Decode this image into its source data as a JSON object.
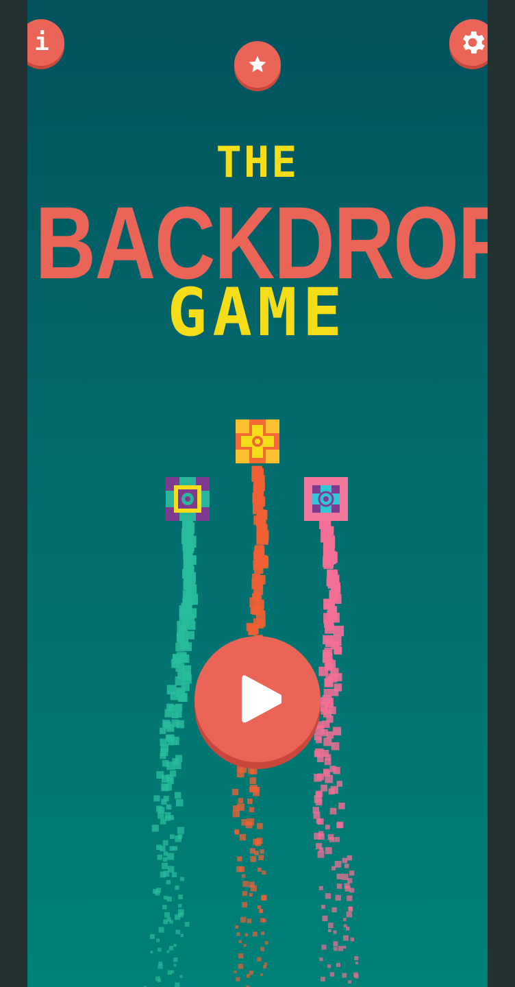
{
  "title": {
    "line1": "THE",
    "line2": "BACKDROP",
    "line3": "GAME"
  },
  "buttons": {
    "info": {
      "icon": "info-icon",
      "glyph": "i"
    },
    "achievements": {
      "icon": "star-icon"
    },
    "settings": {
      "icon": "gear-icon"
    },
    "play": {
      "icon": "play-icon"
    }
  },
  "colors": {
    "accent": "#ea6557",
    "title_yellow": "#f6dd1a",
    "teal_trail": "#28bc9c",
    "orange_trail": "#f06034",
    "pink_trail": "#f36f96",
    "bg_top": "#02515d",
    "bg_bottom": "#008076"
  },
  "blocks": [
    {
      "name": "teal-purple-block",
      "trail": "teal"
    },
    {
      "name": "orange-yellow-block",
      "trail": "orange"
    },
    {
      "name": "cyan-pink-block",
      "trail": "pink"
    }
  ]
}
